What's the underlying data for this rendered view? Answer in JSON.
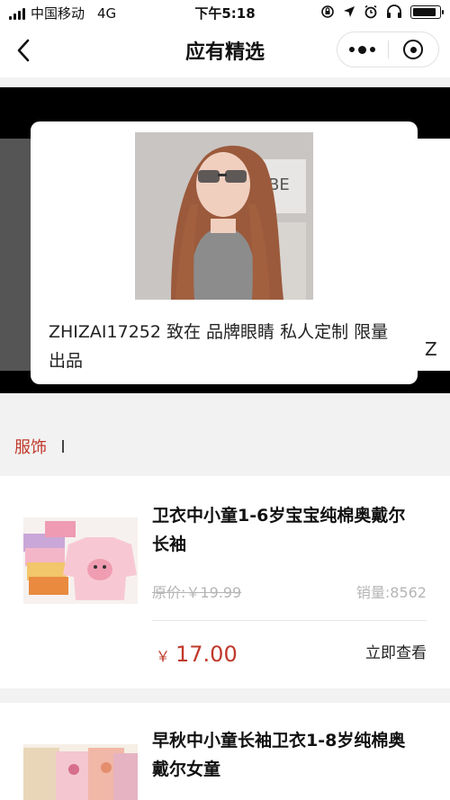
{
  "status_bar": {
    "carrier": "中国移动",
    "network": "4G",
    "time": "下午5:18"
  },
  "nav": {
    "title": "应有精选",
    "more_icon": "more-dots-icon",
    "close_icon": "target-close-icon"
  },
  "banner": {
    "title": "ZHIZAI17252 致在 品牌眼睛 私人定制 限量出品",
    "next_peek": "Z",
    "photo_text": "BE"
  },
  "category": {
    "label": "服饰"
  },
  "products": [
    {
      "name": "卫衣中小童1-6岁宝宝纯棉奥戴尔长袖",
      "original_price": "原价:￥19.99",
      "sales": "销量:8562",
      "currency": "￥",
      "price": "17.00",
      "action": "立即查看"
    },
    {
      "name": "早秋中小童长袖卫衣1-8岁纯棉奥戴尔女童"
    }
  ],
  "colors": {
    "accent": "#c0392b",
    "muted": "#b5b5b5",
    "background": "#f2f2f2"
  }
}
